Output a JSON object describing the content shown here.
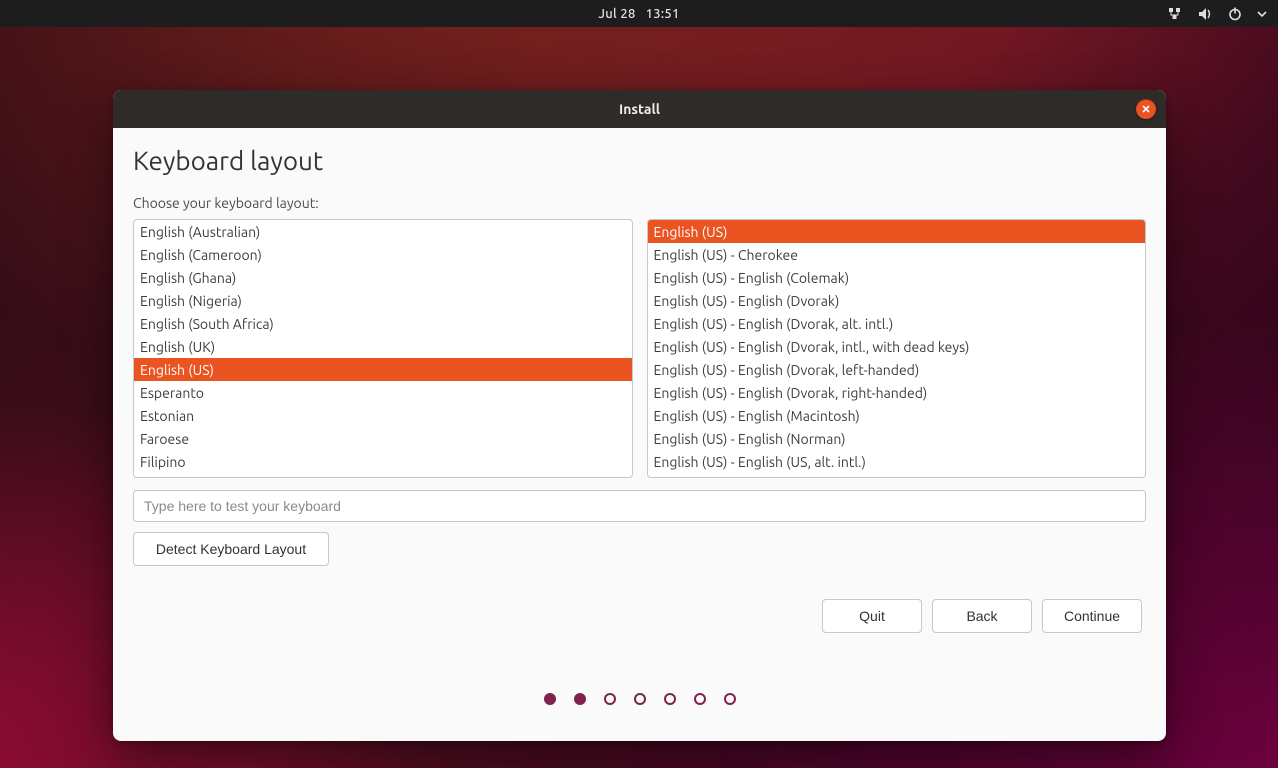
{
  "topbar": {
    "date": "Jul 28",
    "time": "13:51"
  },
  "window": {
    "title": "Install",
    "heading": "Keyboard layout",
    "prompt": "Choose your keyboard layout:",
    "left_list": [
      {
        "label": "English (Australian)",
        "selected": false
      },
      {
        "label": "English (Cameroon)",
        "selected": false
      },
      {
        "label": "English (Ghana)",
        "selected": false
      },
      {
        "label": "English (Nigeria)",
        "selected": false
      },
      {
        "label": "English (South Africa)",
        "selected": false
      },
      {
        "label": "English (UK)",
        "selected": false
      },
      {
        "label": "English (US)",
        "selected": true
      },
      {
        "label": "Esperanto",
        "selected": false
      },
      {
        "label": "Estonian",
        "selected": false
      },
      {
        "label": "Faroese",
        "selected": false
      },
      {
        "label": "Filipino",
        "selected": false
      }
    ],
    "right_list": [
      {
        "label": "English (US)",
        "selected": true
      },
      {
        "label": "English (US) - Cherokee",
        "selected": false
      },
      {
        "label": "English (US) - English (Colemak)",
        "selected": false
      },
      {
        "label": "English (US) - English (Dvorak)",
        "selected": false
      },
      {
        "label": "English (US) - English (Dvorak, alt. intl.)",
        "selected": false
      },
      {
        "label": "English (US) - English (Dvorak, intl., with dead keys)",
        "selected": false
      },
      {
        "label": "English (US) - English (Dvorak, left-handed)",
        "selected": false
      },
      {
        "label": "English (US) - English (Dvorak, right-handed)",
        "selected": false
      },
      {
        "label": "English (US) - English (Macintosh)",
        "selected": false
      },
      {
        "label": "English (US) - English (Norman)",
        "selected": false
      },
      {
        "label": "English (US) - English (US, alt. intl.)",
        "selected": false
      }
    ],
    "test_placeholder": "Type here to test your keyboard",
    "detect_label": "Detect Keyboard Layout",
    "buttons": {
      "quit": "Quit",
      "back": "Back",
      "continue": "Continue"
    },
    "progress": {
      "total": 7,
      "active": 2
    }
  },
  "colors": {
    "accent": "#e95420",
    "progress_dot": "#80224f"
  }
}
